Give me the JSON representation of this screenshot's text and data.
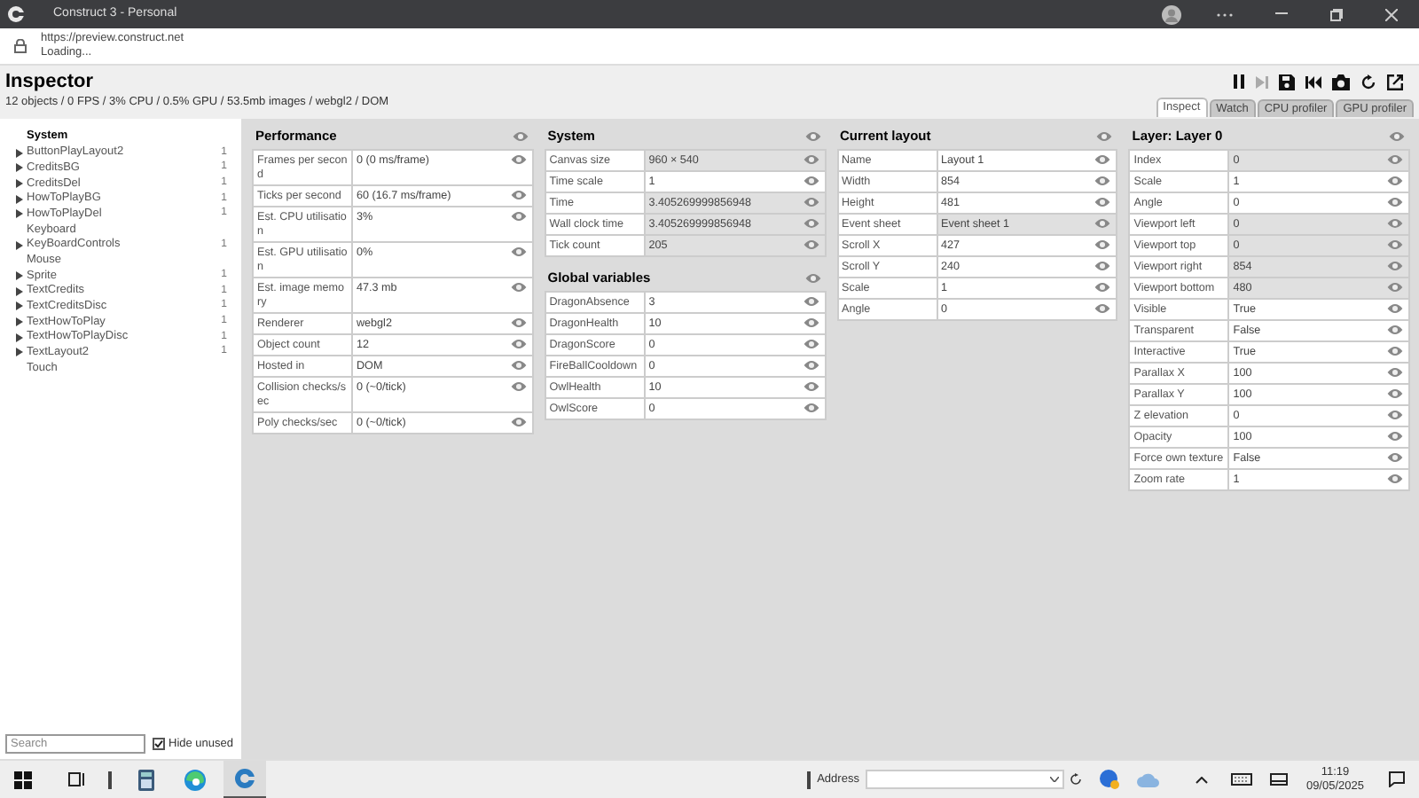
{
  "window": {
    "title": "Construct 3 - Personal"
  },
  "address": {
    "url": "https://preview.construct.net",
    "status": "Loading..."
  },
  "inspector": {
    "title": "Inspector",
    "summary": "12 objects / 0 FPS / 3% CPU / 0.5% GPU / 53.5mb images / webgl2 / DOM"
  },
  "tabs": [
    {
      "label": "Inspect",
      "selected": true
    },
    {
      "label": "Watch",
      "selected": false
    },
    {
      "label": "CPU profiler",
      "selected": false
    },
    {
      "label": "GPU profiler",
      "selected": false
    }
  ],
  "tree": [
    {
      "label": "System",
      "selected": true,
      "expandable": false
    },
    {
      "label": "ButtonPlayLayout2",
      "selected": false,
      "expandable": true,
      "count": "1"
    },
    {
      "label": "CreditsBG",
      "selected": false,
      "expandable": true,
      "count": "1"
    },
    {
      "label": "CreditsDel",
      "selected": false,
      "expandable": true,
      "count": "1"
    },
    {
      "label": "HowToPlayBG",
      "selected": false,
      "expandable": true,
      "count": "1"
    },
    {
      "label": "HowToPlayDel",
      "selected": false,
      "expandable": true,
      "count": "1"
    },
    {
      "label": "Keyboard",
      "selected": false,
      "expandable": false
    },
    {
      "label": "KeyBoardControls",
      "selected": false,
      "expandable": true,
      "count": "1"
    },
    {
      "label": "Mouse",
      "selected": false,
      "expandable": false
    },
    {
      "label": "Sprite",
      "selected": false,
      "expandable": true,
      "count": "1"
    },
    {
      "label": "TextCredits",
      "selected": false,
      "expandable": true,
      "count": "1"
    },
    {
      "label": "TextCreditsDisc",
      "selected": false,
      "expandable": true,
      "count": "1"
    },
    {
      "label": "TextHowToPlay",
      "selected": false,
      "expandable": true,
      "count": "1"
    },
    {
      "label": "TextHowToPlayDisc",
      "selected": false,
      "expandable": true,
      "count": "1"
    },
    {
      "label": "TextLayout2",
      "selected": false,
      "expandable": true,
      "count": "1"
    },
    {
      "label": "Touch",
      "selected": false,
      "expandable": false
    }
  ],
  "search": {
    "placeholder": "Search",
    "hide_unused": {
      "label": "Hide unused",
      "checked": true
    }
  },
  "columns": [
    [
      {
        "title": "Performance",
        "rows": [
          {
            "label": "Frames per second",
            "value": "0 (0 ms/frame)",
            "highlight": false
          },
          {
            "label": "Ticks per second",
            "value": "60 (16.7 ms/frame)",
            "highlight": false
          },
          {
            "label": "Est. CPU utilisation",
            "value": "3%",
            "highlight": false
          },
          {
            "label": "Est. GPU utilisation",
            "value": "0%",
            "highlight": false
          },
          {
            "label": "Est. image memory",
            "value": "47.3 mb",
            "highlight": false
          },
          {
            "label": "Renderer",
            "value": "webgl2",
            "highlight": false
          },
          {
            "label": "Object count",
            "value": "12",
            "highlight": false
          },
          {
            "label": "Hosted in",
            "value": "DOM",
            "highlight": false
          },
          {
            "label": "Collision checks/sec",
            "value": "0 (~0/tick)",
            "highlight": false
          },
          {
            "label": "Poly checks/sec",
            "value": "0 (~0/tick)",
            "highlight": false
          }
        ]
      }
    ],
    [
      {
        "title": "System",
        "rows": [
          {
            "label": "Canvas size",
            "value": "960 × 540",
            "highlight": true
          },
          {
            "label": "Time scale",
            "value": "1",
            "highlight": false
          },
          {
            "label": "Time",
            "value": "3.405269999856948",
            "highlight": true
          },
          {
            "label": "Wall clock time",
            "value": "3.405269999856948",
            "highlight": true
          },
          {
            "label": "Tick count",
            "value": "205",
            "highlight": true
          }
        ]
      },
      {
        "title": "Global variables",
        "rows": [
          {
            "label": "DragonAbsence",
            "value": "3",
            "highlight": false
          },
          {
            "label": "DragonHealth",
            "value": "10",
            "highlight": false
          },
          {
            "label": "DragonScore",
            "value": "0",
            "highlight": false
          },
          {
            "label": "FireBallCooldown",
            "value": "0",
            "highlight": false
          },
          {
            "label": "OwlHealth",
            "value": "10",
            "highlight": false
          },
          {
            "label": "OwlScore",
            "value": "0",
            "highlight": false
          }
        ]
      }
    ],
    [
      {
        "title": "Current layout",
        "rows": [
          {
            "label": "Name",
            "value": "Layout 1",
            "highlight": false
          },
          {
            "label": "Width",
            "value": "854",
            "highlight": false
          },
          {
            "label": "Height",
            "value": "481",
            "highlight": false
          },
          {
            "label": "Event sheet",
            "value": "Event sheet 1",
            "highlight": true
          },
          {
            "label": "Scroll X",
            "value": "427",
            "highlight": false
          },
          {
            "label": "Scroll Y",
            "value": "240",
            "highlight": false
          },
          {
            "label": "Scale",
            "value": "1",
            "highlight": false
          },
          {
            "label": "Angle",
            "value": "0",
            "highlight": false
          }
        ]
      }
    ],
    [
      {
        "title": "Layer: Layer 0",
        "rows": [
          {
            "label": "Index",
            "value": "0",
            "highlight": true
          },
          {
            "label": "Scale",
            "value": "1",
            "highlight": false
          },
          {
            "label": "Angle",
            "value": "0",
            "highlight": false
          },
          {
            "label": "Viewport left",
            "value": "0",
            "highlight": true
          },
          {
            "label": "Viewport top",
            "value": "0",
            "highlight": true
          },
          {
            "label": "Viewport right",
            "value": "854",
            "highlight": true
          },
          {
            "label": "Viewport bottom",
            "value": "480",
            "highlight": true
          },
          {
            "label": "Visible",
            "value": "True",
            "highlight": false
          },
          {
            "label": "Transparent",
            "value": "False",
            "highlight": false
          },
          {
            "label": "Interactive",
            "value": "True",
            "highlight": false
          },
          {
            "label": "Parallax X",
            "value": "100",
            "highlight": false
          },
          {
            "label": "Parallax Y",
            "value": "100",
            "highlight": false
          },
          {
            "label": "Z elevation",
            "value": "0",
            "highlight": false
          },
          {
            "label": "Opacity",
            "value": "100",
            "highlight": false
          },
          {
            "label": "Force own texture",
            "value": "False",
            "highlight": false
          },
          {
            "label": "Zoom rate",
            "value": "1",
            "highlight": false
          }
        ]
      }
    ]
  ],
  "taskbar": {
    "address_label": "Address",
    "time": "11:19",
    "date": "09/05/2025"
  }
}
